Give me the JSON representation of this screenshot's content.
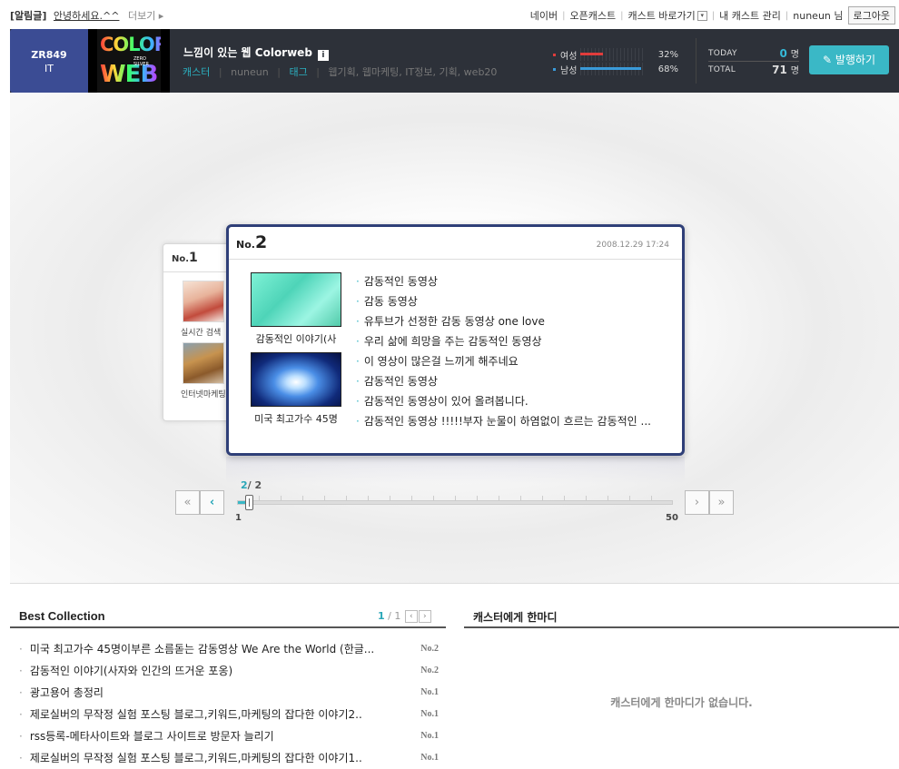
{
  "notice": {
    "tag": "[알림글]",
    "message": "안녕하세요.^^",
    "more": "더보기 ▸"
  },
  "topnav": {
    "naver": "네이버",
    "opencast": "오픈캐스트",
    "shortcut": "캐스트 바로가기",
    "manage": "내 캐스트 관리",
    "user": "nuneun 님",
    "logout": "로그아웃"
  },
  "header": {
    "rank_code": "ZR849",
    "category": "IT",
    "logo_word1": "COLOR",
    "logo_word2": "WEB",
    "logo_sub": "ZERO SILVER",
    "title": "느낌이 있는 웹 Colorweb",
    "caster_label": "캐스터",
    "caster_name": "nuneun",
    "tag_label": "태그",
    "tags": "웹기획, 웹마케팅, IT정보, 기획, web20"
  },
  "gender": {
    "female": {
      "label": "여성",
      "pct_text": "32%",
      "value": 0.32,
      "color": "#e03c3c"
    },
    "male": {
      "label": "남성",
      "pct_text": "68%",
      "value": 0.68,
      "color": "#3a9ad9"
    }
  },
  "visits": {
    "today_label": "TODAY",
    "today": "0",
    "total_label": "TOTAL",
    "total": "71",
    "unit": "명"
  },
  "publish_label": "✎ 발행하기",
  "back_card": {
    "no_prefix": "No.",
    "no": "1",
    "captions": [
      "실시간 검색",
      "인터넷마케팅"
    ]
  },
  "card": {
    "no_prefix": "No.",
    "no": "2",
    "date": "2008.12.29 17:24",
    "thumb_captions": [
      "감동적인 이야기(사",
      "미국 최고가수 45명"
    ],
    "posts": [
      "감동적인 동영상",
      "감동 동영상",
      "유투브가 선정한 감동 동영상 one love",
      "우리 삶에 희망을 주는 감동적인 동영상",
      "이 영상이 많은걸 느끼게 해주네요",
      "감동적인 동영상",
      "감동적인 동영상이 있어 올려봅니다.",
      "감동적인 동영상 !!!!!부자 눈물이 하염없이 흐르는 감동적인 ..."
    ]
  },
  "pager": {
    "current": "2",
    "total": "/ 2",
    "min": "1",
    "max": "50",
    "progress": 0.02
  },
  "best": {
    "title": "Best Collection",
    "page_current": "1",
    "page_total": "/ 1",
    "items": [
      {
        "title": "미국 최고가수 45명이부른 소름돋는 감동영상 We Are the World (한글...",
        "no": "No.2"
      },
      {
        "title": "감동적인 이야기(사자와 인간의 뜨거운 포옹)",
        "no": "No.2"
      },
      {
        "title": "광고용어 총정리",
        "no": "No.1"
      },
      {
        "title": "제로실버의 무작정 실험 포스팅 블로그,키워드,마케팅의 잡다한 이야기2..",
        "no": "No.1"
      },
      {
        "title": "rss등록-메타사이트와 블로그 사이트로 방문자 늘리기",
        "no": "No.1"
      },
      {
        "title": "제로실버의 무작정 실험 포스팅 블로그,키워드,마케팅의 잡다한 이야기1..",
        "no": "No.1"
      }
    ]
  },
  "messages": {
    "title": "캐스터에게 한마디",
    "empty": "캐스터에게 한마디가 없습니다."
  },
  "icons": {
    "first": "«",
    "prev": "‹",
    "next": "›",
    "last": "»",
    "prev_small": "‹",
    "next_small": "›",
    "info": "i",
    "dropdown": "▾"
  }
}
